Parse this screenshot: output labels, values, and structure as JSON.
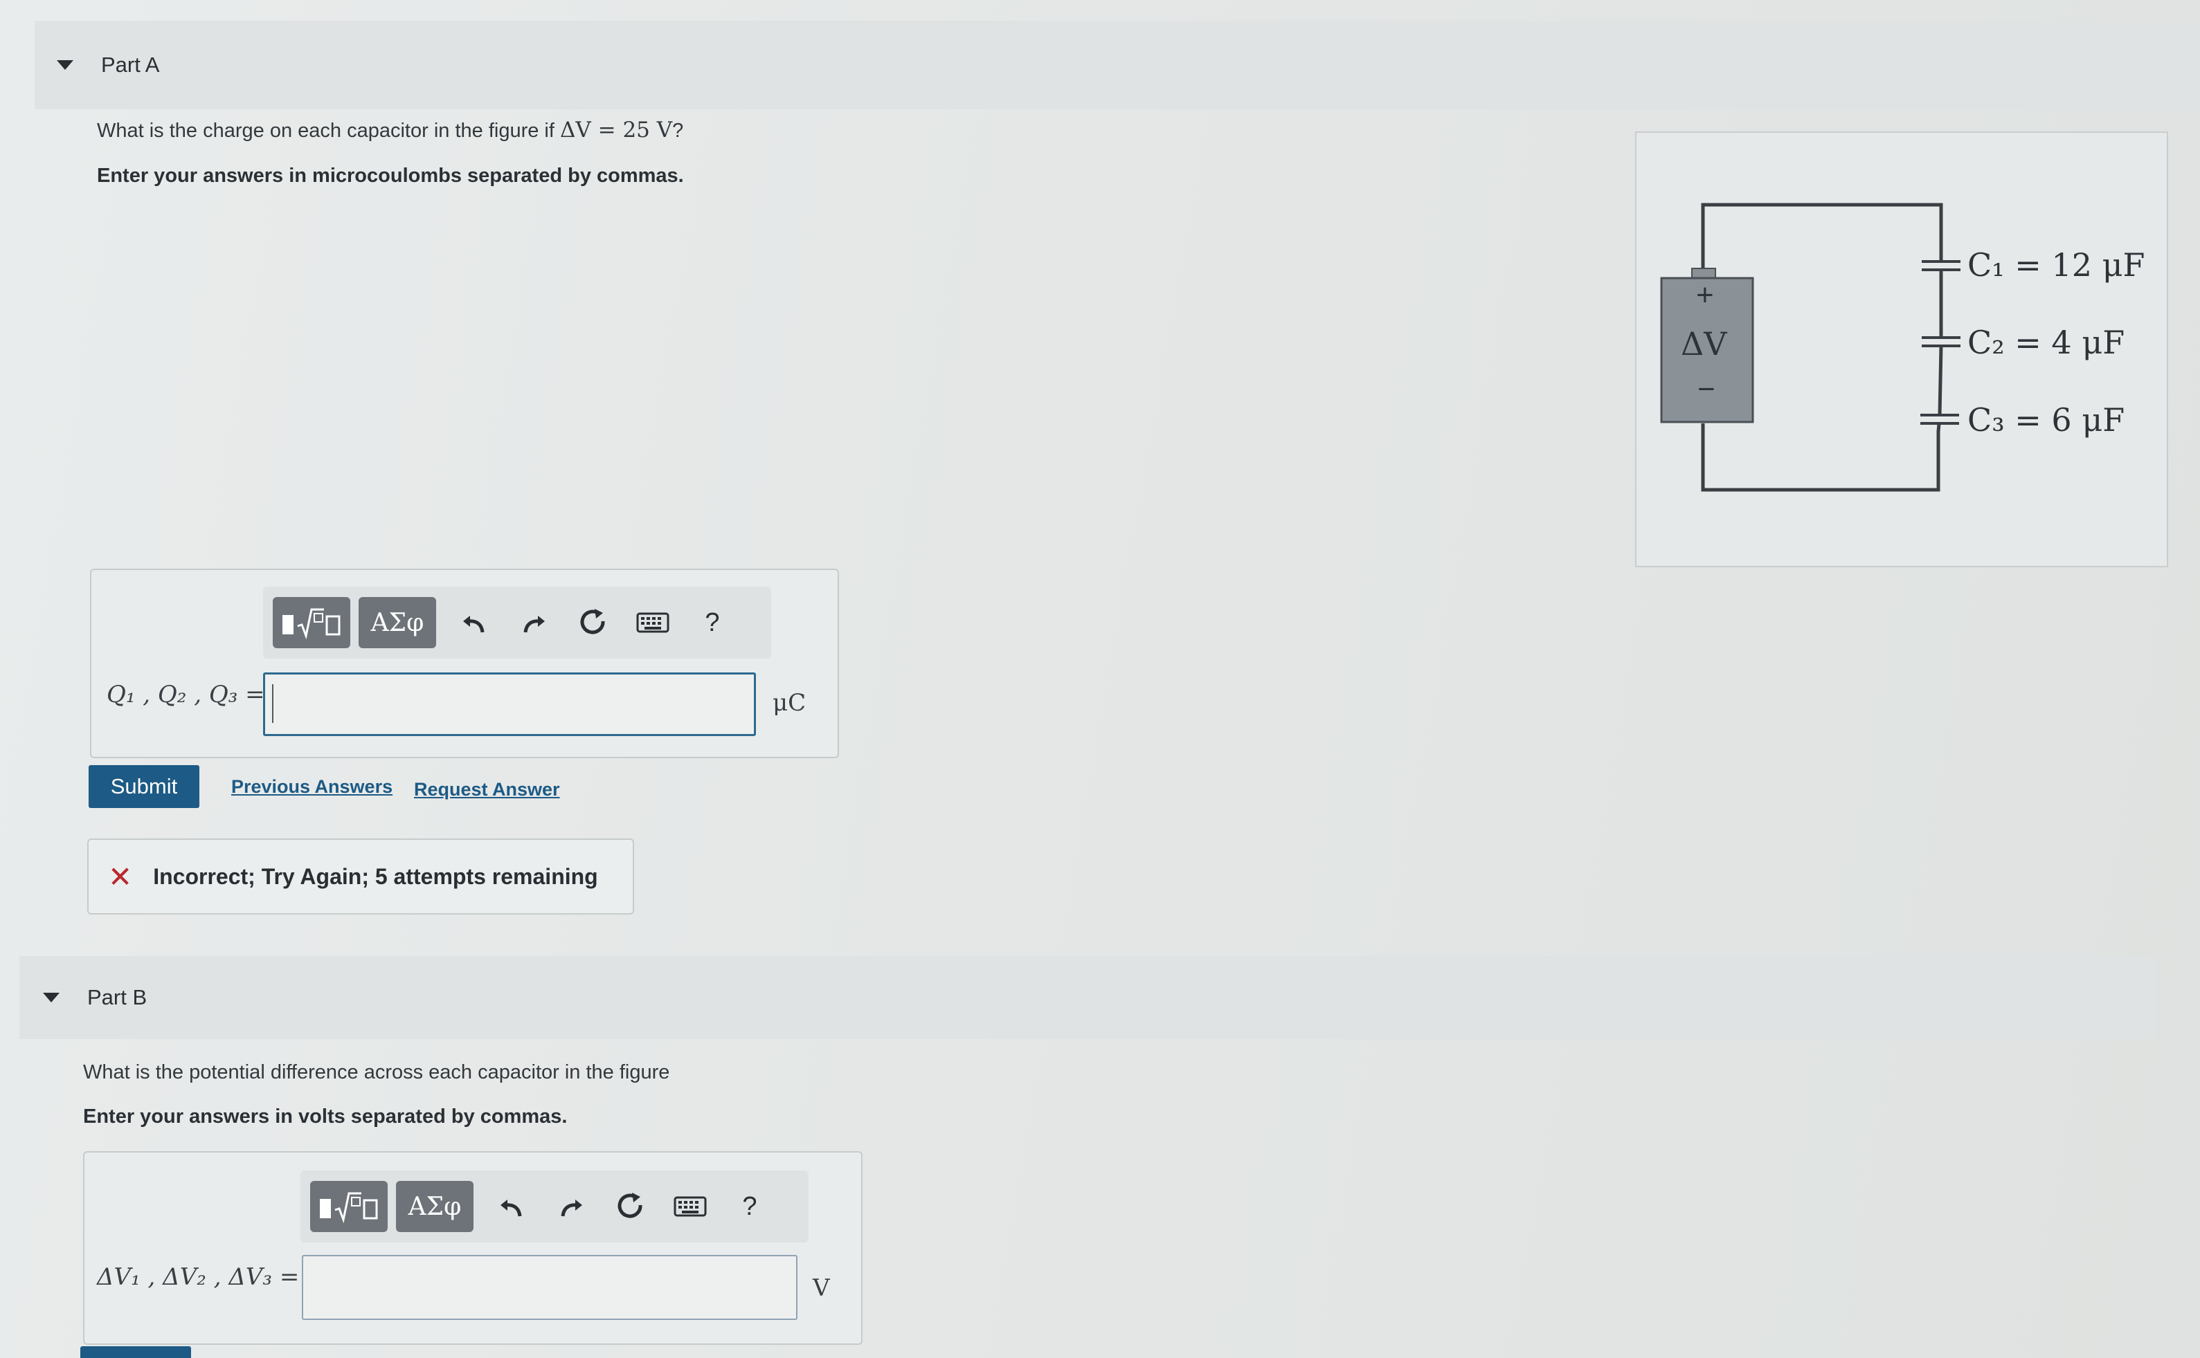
{
  "part_a": {
    "header": "Part A",
    "question_prefix": "What is the charge on each capacitor in the figure if",
    "question_math": "ΔV = 25 V",
    "question_suffix": "?",
    "instruction": "Enter your answers in microcoulombs separated by commas.",
    "answer_label": "Q₁ , Q₂ , Q₃ =",
    "answer_value": "",
    "unit": "μC",
    "toolbar": {
      "greek": "ΑΣφ",
      "help": "?"
    },
    "submit_label": "Submit",
    "previous_answers": "Previous Answers",
    "request_answer": "Request Answer",
    "feedback": "Incorrect; Try Again; 5 attempts remaining"
  },
  "part_b": {
    "header": "Part B",
    "question": "What is the potential difference across each capacitor in the figure",
    "instruction": "Enter your answers in volts separated by commas.",
    "answer_label": "ΔV₁ , ΔV₂ , ΔV₃ =",
    "answer_value": "",
    "unit": "V",
    "toolbar": {
      "greek": "ΑΣφ",
      "help": "?"
    }
  },
  "figure": {
    "battery_plus": "+",
    "battery_label": "ΔV",
    "battery_minus": "−",
    "c1": "C₁ = 12 μF",
    "c2": "C₂ = 4 μF",
    "c3": "C₃ = 6 μF"
  },
  "colors": {
    "primary": "#1d5a85",
    "error": "#b8282e",
    "tool_button": "#6d7378"
  }
}
